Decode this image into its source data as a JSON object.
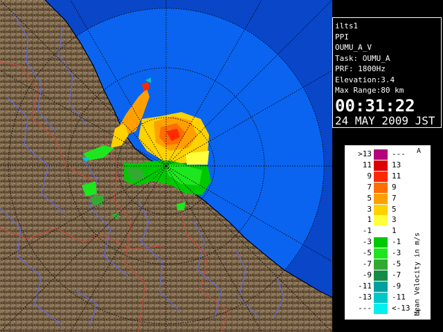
{
  "info": {
    "radar": "ilts1",
    "scan": "PPI",
    "product": "OUMU_A_V",
    "task": "Task: OUMU_A",
    "prf": "PRF: 1800Hz",
    "elevation": "Elevation:3.4",
    "max_range": "Max Range:80 km",
    "time": "00:31:22",
    "date": "24 MAY 2009 JST"
  },
  "legend": {
    "title": "Mean Velocity in m/s",
    "top_mark": "A",
    "bottom_mark": "T",
    "rows": [
      {
        "lo": ">13",
        "hi": "---",
        "color": "#b4007d"
      },
      {
        "lo": "11",
        "hi": "13",
        "color": "#dc0000"
      },
      {
        "lo": "9",
        "hi": "11",
        "color": "#ff2800"
      },
      {
        "lo": "7",
        "hi": "9",
        "color": "#ff6e00"
      },
      {
        "lo": "5",
        "hi": "7",
        "color": "#ffa000"
      },
      {
        "lo": "3",
        "hi": "5",
        "color": "#ffd200"
      },
      {
        "lo": "1",
        "hi": "3",
        "color": "#ffff3c"
      },
      {
        "lo": "-1",
        "hi": "1",
        "color": "#ffffff"
      },
      {
        "lo": "-3",
        "hi": "-1",
        "color": "#00c800"
      },
      {
        "lo": "-5",
        "hi": "-3",
        "color": "#1ee61e"
      },
      {
        "lo": "-7",
        "hi": "-5",
        "color": "#32aa32"
      },
      {
        "lo": "-9",
        "hi": "-7",
        "color": "#148c46"
      },
      {
        "lo": "-11",
        "hi": "-9",
        "color": "#00a0a0"
      },
      {
        "lo": "-13",
        "hi": "-11",
        "color": "#00c8c8"
      },
      {
        "lo": "---",
        "hi": "<-13",
        "color": "#00f0f0"
      }
    ]
  },
  "colors": {
    "sea": "#0a64f0",
    "sea_far": "#0050dc",
    "land": "#7a6448",
    "river": "#5a6cff",
    "border": "#c84a3c",
    "grid": "#000000"
  }
}
